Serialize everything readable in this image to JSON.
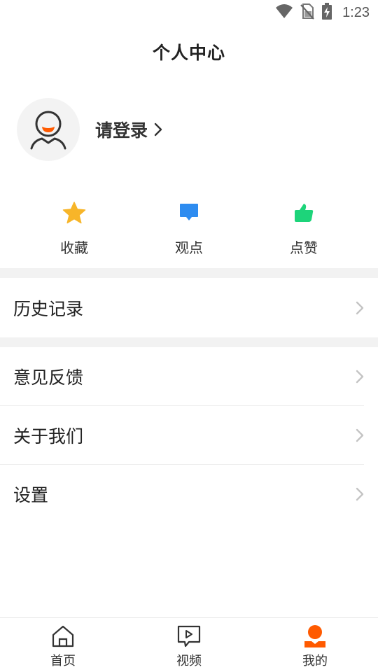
{
  "status_bar": {
    "time": "1:23",
    "icons": [
      "wifi-icon",
      "no-sim-icon",
      "battery-charging-icon"
    ]
  },
  "header": {
    "title": "个人中心"
  },
  "profile": {
    "login_label": "请登录",
    "avatar_icon": "default-avatar-icon"
  },
  "quick_actions": [
    {
      "label": "收藏",
      "icon": "star-icon",
      "color": "#F7B529"
    },
    {
      "label": "观点",
      "icon": "comment-icon",
      "color": "#2E8CF0"
    },
    {
      "label": "点赞",
      "icon": "thumbs-up-icon",
      "color": "#1DD47A"
    }
  ],
  "menu": {
    "history": "历史记录",
    "feedback": "意见反馈",
    "about": "关于我们",
    "settings": "设置"
  },
  "tab_bar": {
    "active_color": "#FF5A00",
    "tabs": [
      {
        "label": "首页",
        "icon": "home-icon",
        "active": false
      },
      {
        "label": "视频",
        "icon": "video-icon",
        "active": false
      },
      {
        "label": "我的",
        "icon": "profile-icon",
        "active": true
      }
    ]
  }
}
